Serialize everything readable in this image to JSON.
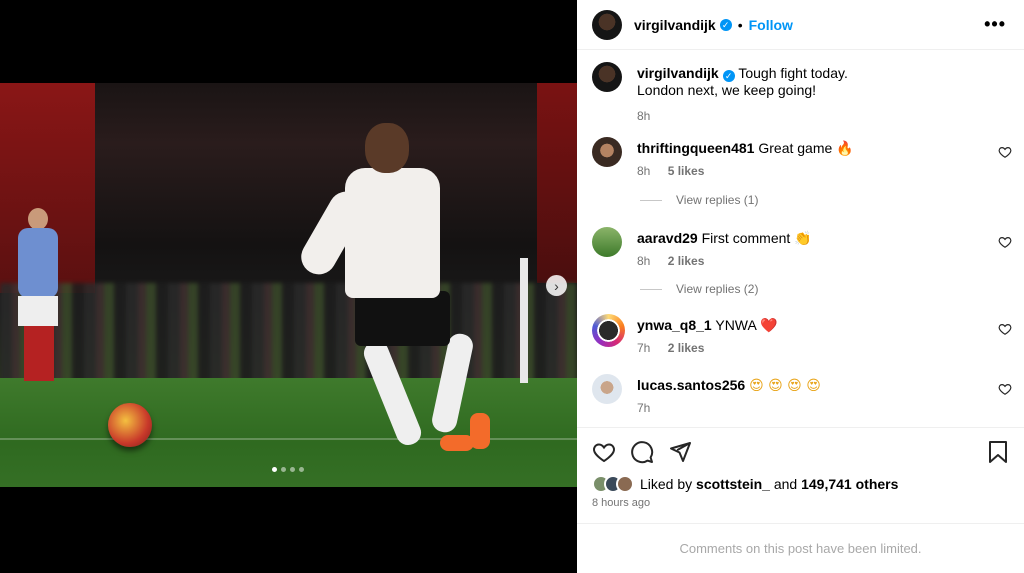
{
  "post": {
    "author": "virgilvandijk",
    "follow_label": "Follow",
    "more_label": "•••",
    "caption_line1": "Tough fight today.",
    "caption_line2": "London next, we keep going!",
    "caption_time": "8h",
    "carousel": {
      "current": 1,
      "total": 4,
      "next_icon": "chevron-right-icon"
    }
  },
  "comments": [
    {
      "user": "thriftingqueen481",
      "text": "Great game",
      "emoji": "🔥",
      "time": "8h",
      "likes": "5 likes",
      "replies": "View replies (1)"
    },
    {
      "user": "aaravd29",
      "text": "First comment",
      "emoji": "👏",
      "time": "8h",
      "likes": "2 likes",
      "replies": "View replies (2)"
    },
    {
      "user": "ynwa_q8_1",
      "text": "YNWA",
      "emoji": "❤️",
      "time": "7h",
      "likes": "2 likes"
    },
    {
      "user": "lucas.santos256",
      "text": "",
      "emoji": "😍 😍 😍 😍",
      "time": "7h"
    }
  ],
  "footer": {
    "liked_by_prefix": "Liked by",
    "liked_by_user": "scottstein_",
    "and": "and",
    "others": "149,741 others",
    "time_ago": "8 hours ago",
    "limited_notice": "Comments on this post have been limited."
  },
  "icons": [
    "heart-icon",
    "comment-icon",
    "share-icon",
    "bookmark-icon",
    "verified-icon",
    "more-icon"
  ],
  "colors": {
    "accent": "#0095f6",
    "muted": "#737373"
  }
}
